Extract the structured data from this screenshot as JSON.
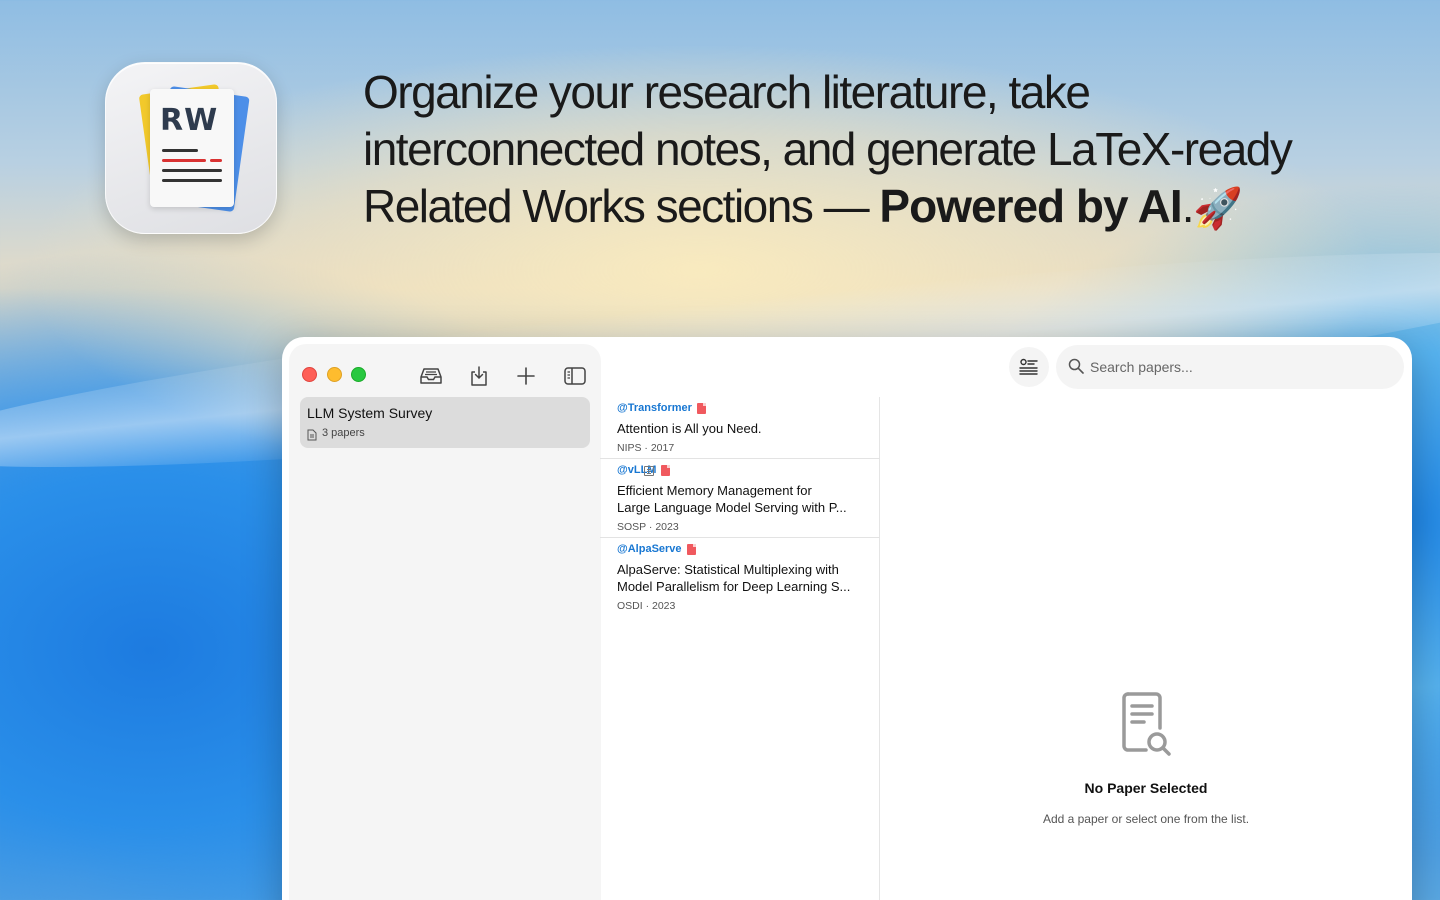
{
  "hero": {
    "icon_label": "RW",
    "headline_line1": "Organize your research literature, take",
    "headline_line2": "interconnected notes, and generate LaTeX-ready",
    "headline_line3_pre": "Related Works sections — ",
    "headline_bold": "Powered by AI",
    "headline_post": ".",
    "rocket": "🚀"
  },
  "toolbar": {
    "icons": [
      "inbox-icon",
      "import-icon",
      "plus-icon",
      "sidebar-toggle-icon"
    ]
  },
  "sidebar": {
    "collections": [
      {
        "title": "LLM System Survey",
        "count": "3 papers"
      }
    ]
  },
  "papers": [
    {
      "key": "@Transformer",
      "title_l1": "Attention is All you Need.",
      "title_l2": "",
      "meta": "NIPS · 2017",
      "has_note": false,
      "has_pdf": true
    },
    {
      "key": "@vLLM",
      "title_l1": "Efficient Memory Management for",
      "title_l2": "Large Language Model Serving with P...",
      "meta": "SOSP · 2023",
      "has_note": true,
      "has_pdf": true
    },
    {
      "key": "@AlpaServe",
      "title_l1": "AlpaServe: Statistical Multiplexing with",
      "title_l2": "Model Parallelism for Deep Learning S...",
      "meta": "OSDI · 2023",
      "has_note": false,
      "has_pdf": true
    }
  ],
  "search": {
    "placeholder": "Search papers..."
  },
  "detail": {
    "empty_title": "No Paper Selected",
    "empty_subtitle": "Add a paper or select one from the list."
  },
  "colors": {
    "accent": "#1877d2",
    "pdf": "#f0595e",
    "close": "#fe5f57",
    "minimize": "#febc2e",
    "zoom": "#28c840"
  }
}
